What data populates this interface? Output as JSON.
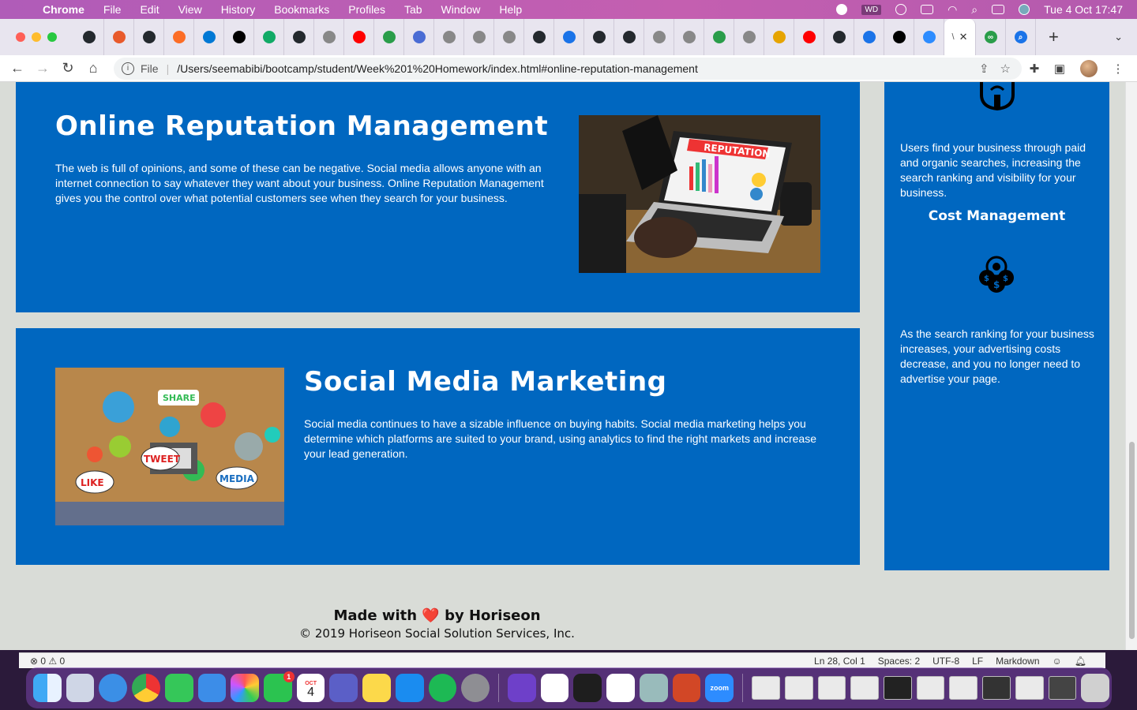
{
  "menubar": {
    "app_name": "Chrome",
    "items": [
      "File",
      "Edit",
      "View",
      "History",
      "Bookmarks",
      "Profiles",
      "Tab",
      "Window",
      "Help"
    ],
    "clock": "Tue 4 Oct  17:47",
    "wd_badge": "WD"
  },
  "browser": {
    "url_scheme": "File",
    "url": "/Users/seemabibi/bootcamp/student/Week%201%20Homework/index.html#online-reputation-management",
    "active_tab_label": "\\",
    "tab_icons": [
      "github-icon",
      "asterisk-icon",
      "github-icon",
      "gitlab-icon",
      "outlook-icon",
      "medium-icon",
      "wb-icon",
      "github-icon",
      "globe-icon",
      "youtube-icon",
      "w-icon",
      "w-circle-icon",
      "globe-icon",
      "globe-icon",
      "globe-icon",
      "github-icon",
      "search-icon",
      "github-icon",
      "github-icon",
      "globe-icon",
      "globe-icon",
      "w-icon",
      "globe-icon",
      "fs-icon",
      "youtube-icon",
      "github-icon",
      "search-icon",
      "medium-icon",
      "zoom-icon"
    ]
  },
  "sections": {
    "orm": {
      "title": "Online Reputation Management",
      "body": "The web is full of opinions, and some of these can be negative. Social media allows anyone with an internet connection to say whatever they want about your business. Online Reputation Management gives you the control over what potential customers see when they search for your business.",
      "image_text": "REPUTATION"
    },
    "smm": {
      "title": "Social Media Marketing",
      "body": "Social media continues to have a sizable influence on buying habits. Social media marketing helps you determine which platforms are suited to your brand, using analytics to find the right markets and increase your lead generation.",
      "image_words": [
        "SHARE",
        "TWEET",
        "LIKE",
        "MEDIA"
      ]
    }
  },
  "aside": {
    "lead_text": "Users find your business through paid and organic searches, increasing the search ranking and visibility for your business.",
    "cost_title": "Cost Management",
    "cost_text": "As the search ranking for your business increases, your advertising costs decrease, and you no longer need to advertise your page."
  },
  "footer": {
    "made_with": "Made with",
    "heart": "❤️",
    "by": "by Horiseon",
    "copyright": "© 2019 Horiseon Social Solution Services, Inc."
  },
  "editor_status": {
    "problems": "⊗ 0 ⚠ 0",
    "position": "Ln 28, Col 1",
    "spaces": "Spaces: 2",
    "encoding": "UTF-8",
    "eol": "LF",
    "language": "Markdown"
  },
  "dock": {
    "calendar_month": "OCT",
    "calendar_day": "4",
    "facetime_badge": "1",
    "zoom_label": "zoom"
  },
  "colors": {
    "section_blue": "#0067c0",
    "page_bg": "#d9dcd7",
    "menubar": "#c45fb0"
  }
}
